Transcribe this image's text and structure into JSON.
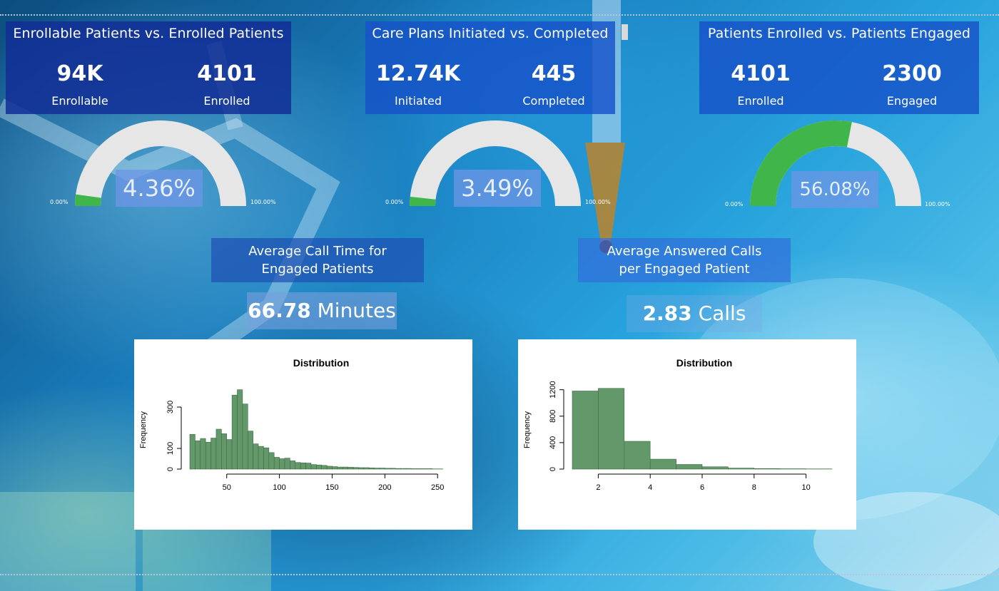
{
  "kpi": [
    {
      "title": "Enrollable Patients vs. Enrolled Patients",
      "left_value": "94K",
      "left_label": "Enrollable",
      "right_value": "4101",
      "right_label": "Enrolled",
      "gauge_pct": 4.36,
      "gauge_text": "4.36%",
      "gauge_min": "0.00%",
      "gauge_max": "100.00%"
    },
    {
      "title": "Care Plans Initiated vs. Completed",
      "left_value": "12.74K",
      "left_label": "Initiated",
      "right_value": "445",
      "right_label": "Completed",
      "gauge_pct": 3.49,
      "gauge_text": "3.49%",
      "gauge_min": "0.00%",
      "gauge_max": "100.00%"
    },
    {
      "title": "Patients Enrolled vs. Patients Engaged",
      "left_value": "4101",
      "left_label": "Enrolled",
      "right_value": "2300",
      "right_label": "Engaged",
      "gauge_pct": 56.08,
      "gauge_text": "56.08%",
      "gauge_min": "0.00%",
      "gauge_max": "100.00%"
    }
  ],
  "metrics": [
    {
      "title_line1": "Average Call Time for",
      "title_line2": "Engaged Patients",
      "value": "66.78",
      "unit": "Minutes"
    },
    {
      "title_line1": "Average Answered Calls",
      "title_line2": "per Engaged Patient",
      "value": "2.83",
      "unit": "Calls"
    }
  ],
  "colors": {
    "gauge_fill": "#3fb54a",
    "gauge_track": "#e6e6e6",
    "bar_fill": "#63996a",
    "bar_stroke": "#3c6b42"
  },
  "chart_data": [
    {
      "type": "bar",
      "title": "Distribution",
      "xlabel": "",
      "ylabel": "Frequency",
      "bin_start": 15,
      "bin_width": 5,
      "values": [
        168,
        137,
        148,
        130,
        150,
        193,
        171,
        143,
        358,
        384,
        315,
        184,
        122,
        110,
        103,
        80,
        57,
        50,
        53,
        40,
        32,
        30,
        29,
        22,
        20,
        18,
        14,
        12,
        10,
        10,
        9,
        8,
        7,
        7,
        6,
        5,
        5,
        4,
        4,
        3,
        3,
        3,
        2,
        2,
        2,
        2,
        1,
        1
      ],
      "xlim": [
        15,
        260
      ],
      "ylim": [
        0,
        400
      ],
      "xticks": [
        50,
        100,
        150,
        200,
        250
      ],
      "yticks": [
        0,
        100,
        300
      ]
    },
    {
      "type": "bar",
      "title": "Distribution",
      "xlabel": "",
      "ylabel": "Frequency",
      "bin_start": 1,
      "bin_width": 1,
      "values": [
        1180,
        1220,
        420,
        150,
        70,
        35,
        15,
        8,
        5,
        3
      ],
      "xlim": [
        1,
        11
      ],
      "ylim": [
        0,
        1250
      ],
      "xticks": [
        2,
        4,
        6,
        8,
        10
      ],
      "yticks": [
        0,
        400,
        800,
        1200
      ]
    }
  ]
}
